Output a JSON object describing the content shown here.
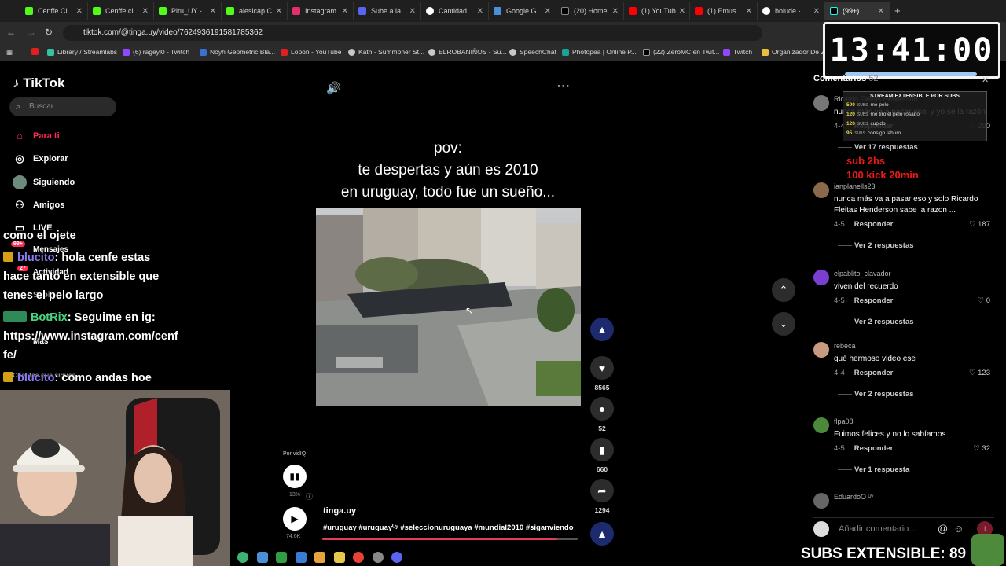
{
  "tabs": [
    {
      "label": "Cenffe Cli"
    },
    {
      "label": "Cenffe cli"
    },
    {
      "label": "Piru_UY -"
    },
    {
      "label": "alesicap C"
    },
    {
      "label": "Instagram"
    },
    {
      "label": "Sube a la"
    },
    {
      "label": "Cantidad"
    },
    {
      "label": "Google G"
    },
    {
      "label": "(20) Home"
    },
    {
      "label": "(1) YouTub"
    },
    {
      "label": "(1) Emus"
    },
    {
      "label": "bolude -"
    },
    {
      "label": "(99+)"
    }
  ],
  "address": {
    "url": "tiktok.com/@tinga.uy/video/7624936191581785362"
  },
  "bookmarks": [
    "Library / Streamlabs",
    "(6) rageyl0 - Twitch",
    "Noyh Geometric Bla...",
    "Lopon - YouTube",
    "Kath - Summoner St...",
    "ELROBANIÑOS - Su...",
    "SpeechChat",
    "Photopea | Online P...",
    "(22) ZeroMC en Twit...",
    "Twitch",
    "Organizador De Z"
  ],
  "timer": {
    "time": "13:41:00"
  },
  "sidebar": {
    "logo": "TikTok",
    "search_placeholder": "Buscar",
    "items": [
      "Para ti",
      "Explorar",
      "Siguiendo",
      "Amigos",
      "LIVE",
      "Mensajes",
      "Actividad",
      "Subir",
      "Perfil",
      "Más",
      "Cuentas que sigues"
    ],
    "badge_messages": "99+",
    "badge_activity": "27"
  },
  "chat": {
    "line1": "como el ojete",
    "user1": "blucito",
    "msg1a": ": hola cenfe estas",
    "msg1b": "hace tanto en extensible que",
    "msg1c": "tenes el pelo largo",
    "bot": "BotRix",
    "bot_msg": ": Seguime en ig:",
    "link1": "https://www.instagram.com/cenf",
    "link2": "fe/",
    "user2": "blucito",
    "msg2": ": como andas hoe"
  },
  "video": {
    "caption_1": "pov:",
    "caption_2": "te despertas y aún es 2010",
    "caption_3": "en uruguay, todo fue un sueño...",
    "author": "tinga.uy",
    "hashtags": "#uruguay #uruguayᵁʸ #seleccionuruguaya #mundial2010 #siganviendo",
    "by_label": "Por vidIQ",
    "stat_pct": "13%",
    "stat_views": "74.6K",
    "progress": 0.92
  },
  "actions": {
    "likes": "8565",
    "comments": "52",
    "saves": "660",
    "shares": "1294"
  },
  "comments_panel": {
    "title": "Comentarios",
    "count": "52",
    "items": [
      {
        "user": "Ricardo Fleitas Henderson",
        "text": "nunca más va a pasar eso, y yo se la razón",
        "date": "4-4",
        "reply": "Responder",
        "likes": "290",
        "replies": "Ver 17 respuestas"
      },
      {
        "user": "ianplanells23",
        "text": "nunca más va a pasar eso y solo Ricardo Fleitas Henderson sabe la razon ...",
        "date": "4-5",
        "reply": "Responder",
        "likes": "187",
        "replies": "Ver 2 respuestas"
      },
      {
        "user": "elpablito_clavador",
        "text": "viven del recuerdo",
        "date": "4-5",
        "reply": "Responder",
        "likes": "0",
        "replies": "Ver 2 respuestas"
      },
      {
        "user": "rebeca",
        "text": "qué hermoso video ese",
        "date": "4-4",
        "reply": "Responder",
        "likes": "123",
        "replies": "Ver 2 respuestas"
      },
      {
        "user": "flpa08",
        "text": "Fuimos felices y no lo sabíamos",
        "date": "4-5",
        "reply": "Responder",
        "likes": "32",
        "replies": "Ver 1 respuesta"
      },
      {
        "user": "EduardoO ᵁʸ",
        "text": "",
        "date": "",
        "reply": "",
        "likes": "",
        "replies": ""
      }
    ],
    "add_placeholder": "Añadir comentario..."
  },
  "subs_box": {
    "title": "STREAM EXTENSIBLE POR SUBS",
    "rows": [
      {
        "n": "500",
        "unit": "SUBS",
        "text": "me pelo"
      },
      {
        "n": "120",
        "unit": "SUBS",
        "text": "me tiro el pelo rosado"
      },
      {
        "n": "120",
        "unit": "SUBS",
        "text": "cupido"
      },
      {
        "n": "95",
        "unit": "SUBS",
        "text": "consigo laburo"
      }
    ],
    "red1": "sub 2hs",
    "red2": "100 kick 20min"
  },
  "subs_ext": "SUBS EXTENSIBLE: 89"
}
